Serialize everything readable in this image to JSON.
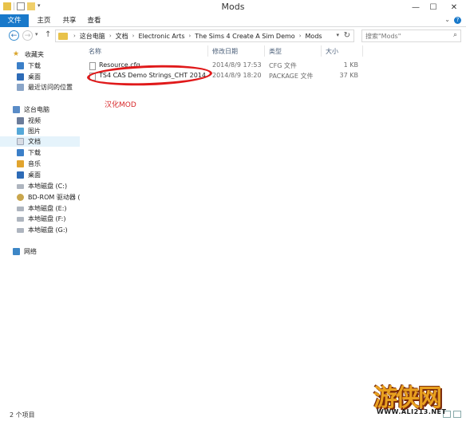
{
  "window": {
    "title": "Mods"
  },
  "ribbon": {
    "tabs": [
      "文件",
      "主页",
      "共享",
      "查看"
    ]
  },
  "address": {
    "crumbs": [
      "这台电脑",
      "文档",
      "Electronic Arts",
      "The Sims 4 Create A Sim Demo",
      "Mods"
    ]
  },
  "search": {
    "placeholder": "搜索\"Mods\""
  },
  "sidebar": {
    "items": [
      {
        "label": "收藏夹",
        "icon": "star-icon"
      },
      {
        "label": "下载",
        "icon": "download-folder-icon"
      },
      {
        "label": "桌面",
        "icon": "desktop-icon"
      },
      {
        "label": "最近访问的位置",
        "icon": "recent-places-icon"
      },
      {
        "label": "这台电脑",
        "icon": "computer-icon"
      },
      {
        "label": "视频",
        "icon": "videos-folder-icon"
      },
      {
        "label": "图片",
        "icon": "pictures-folder-icon"
      },
      {
        "label": "文档",
        "icon": "documents-folder-icon"
      },
      {
        "label": "下载",
        "icon": "download-folder-icon"
      },
      {
        "label": "音乐",
        "icon": "music-folder-icon"
      },
      {
        "label": "桌面",
        "icon": "desktop-icon"
      },
      {
        "label": "本地磁盘 (C:)",
        "icon": "drive-icon"
      },
      {
        "label": "BD-ROM 驱动器 (D",
        "icon": "disc-drive-icon"
      },
      {
        "label": "本地磁盘 (E:)",
        "icon": "drive-icon"
      },
      {
        "label": "本地磁盘 (F:)",
        "icon": "drive-icon"
      },
      {
        "label": "本地磁盘 (G:)",
        "icon": "drive-icon"
      },
      {
        "label": "网络",
        "icon": "network-icon"
      }
    ]
  },
  "columns": {
    "name": "名称",
    "date": "修改日期",
    "type": "类型",
    "size": "大小"
  },
  "files": [
    {
      "name": "Resource.cfg",
      "date": "2014/8/9 17:53",
      "type": "CFG 文件",
      "size": "1 KB"
    },
    {
      "name": "TS4 CAS Demo Strings_CHT 2014080...",
      "date": "2014/8/9 18:20",
      "type": "PACKAGE 文件",
      "size": "37 KB"
    }
  ],
  "annotation": "汉化MOD",
  "status": {
    "item_count": "2 个项目"
  },
  "watermark": {
    "url": "WWW.ALI213.NET"
  },
  "colors": {
    "file_tab": "#1979ca",
    "highlight": "#e0191a",
    "selection": "#e5f3fb"
  }
}
